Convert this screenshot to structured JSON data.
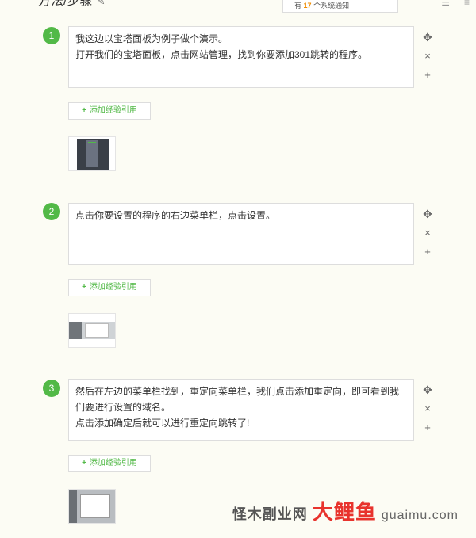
{
  "section": {
    "title": "方法/步骤"
  },
  "notice": {
    "prefix": "有",
    "count": "17",
    "suffix": "个系统通知"
  },
  "steps": [
    {
      "num": "1",
      "lines": [
        "我这边以宝塔面板为例子做个演示。",
        "打开我们的宝塔面板，点击网站管理，找到你要添加301跳转的程序。"
      ],
      "cite": "添加经验引用"
    },
    {
      "num": "2",
      "lines": [
        "点击你要设置的程序的右边菜单栏，点击设置。"
      ],
      "cite": "添加经验引用"
    },
    {
      "num": "3",
      "lines": [
        "然后在左边的菜单栏找到，重定向菜单栏，我们点击添加重定向，即可看到我们要进行设置的域名。",
        "点击添加确定后就可以进行重定向跳转了!"
      ],
      "cite": "添加经验引用"
    }
  ],
  "controls": {
    "move": "✥",
    "delete": "×",
    "add": "+"
  },
  "watermark": {
    "left": "怪木副业网",
    "brand": "大鲤鱼",
    "url": "guaimu.com"
  }
}
